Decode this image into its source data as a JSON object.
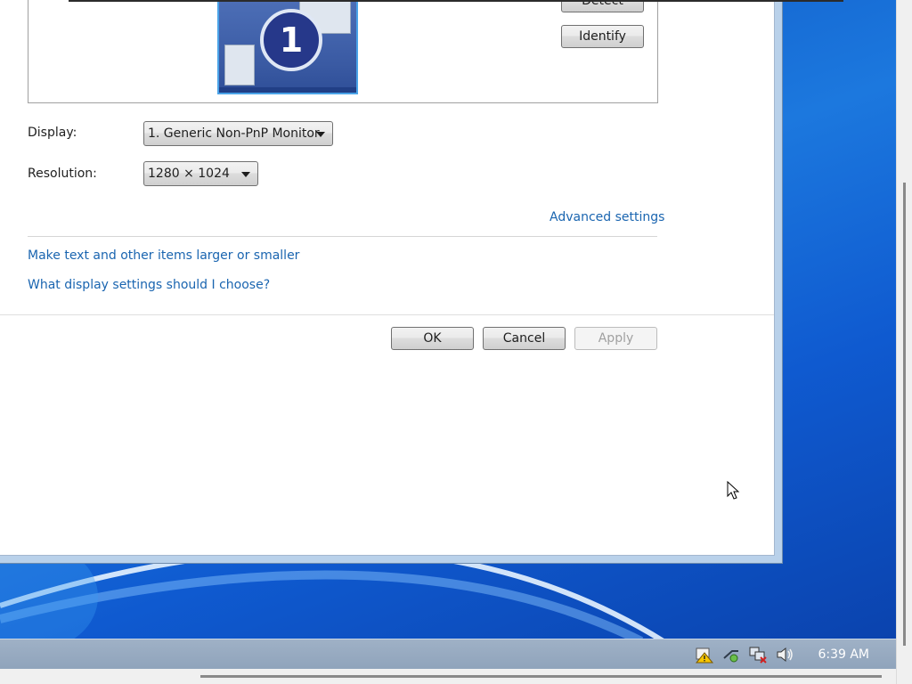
{
  "dialog": {
    "monitor_number": "1",
    "detect_button": "Detect",
    "identify_button": "Identify",
    "display_label": "Display:",
    "display_value": "1. Generic Non-PnP Monitor",
    "resolution_label": "Resolution:",
    "resolution_value": "1280 × 1024",
    "advanced_link": "Advanced settings",
    "link_text_size": "Make text and other items larger or smaller",
    "link_help": "What display settings should I choose?",
    "ok_button": "OK",
    "cancel_button": "Cancel",
    "apply_button": "Apply"
  },
  "taskbar": {
    "clock": "6:39 AM",
    "tray_icons": [
      "action-center-warning-icon",
      "network-icon",
      "network-disconnected-icon",
      "volume-icon"
    ]
  },
  "colors": {
    "link": "#1a65b0",
    "desktop": "#0d57c2",
    "monitor_badge": "#26388a"
  }
}
